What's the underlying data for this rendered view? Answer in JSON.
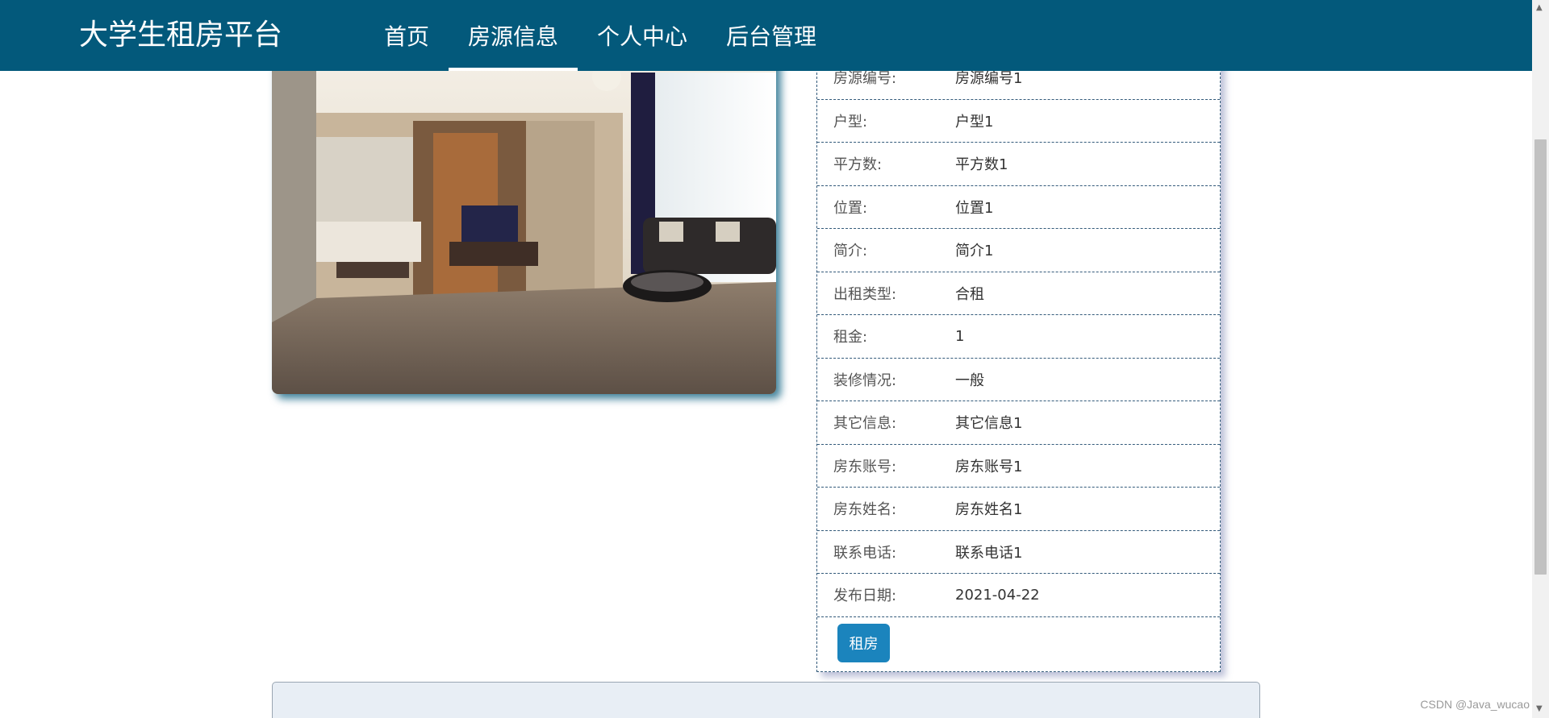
{
  "header": {
    "brand": "大学生租房平台",
    "nav": [
      {
        "label": "首页",
        "active": false
      },
      {
        "label": "房源信息",
        "active": true
      },
      {
        "label": "个人中心",
        "active": false
      },
      {
        "label": "后台管理",
        "active": false
      }
    ]
  },
  "detail": {
    "fields": [
      {
        "label": "房源编号:",
        "value": "房源编号1"
      },
      {
        "label": "户型:",
        "value": "户型1"
      },
      {
        "label": "平方数:",
        "value": "平方数1"
      },
      {
        "label": "位置:",
        "value": "位置1"
      },
      {
        "label": "简介:",
        "value": "简介1"
      },
      {
        "label": "出租类型:",
        "value": "合租"
      },
      {
        "label": "租金:",
        "value": "1"
      },
      {
        "label": "装修情况:",
        "value": "一般"
      },
      {
        "label": "其它信息:",
        "value": "其它信息1"
      },
      {
        "label": "房东账号:",
        "value": "房东账号1"
      },
      {
        "label": "房东姓名:",
        "value": "房东姓名1"
      },
      {
        "label": "联系电话:",
        "value": "联系电话1"
      },
      {
        "label": "发布日期:",
        "value": "2021-04-22"
      }
    ],
    "rent_button": "租房"
  },
  "watermark": "CSDN @Java_wucao",
  "colors": {
    "header_bg": "#03597b",
    "button_bg": "#1b84bd",
    "panel_bg": "#e8eef5"
  }
}
